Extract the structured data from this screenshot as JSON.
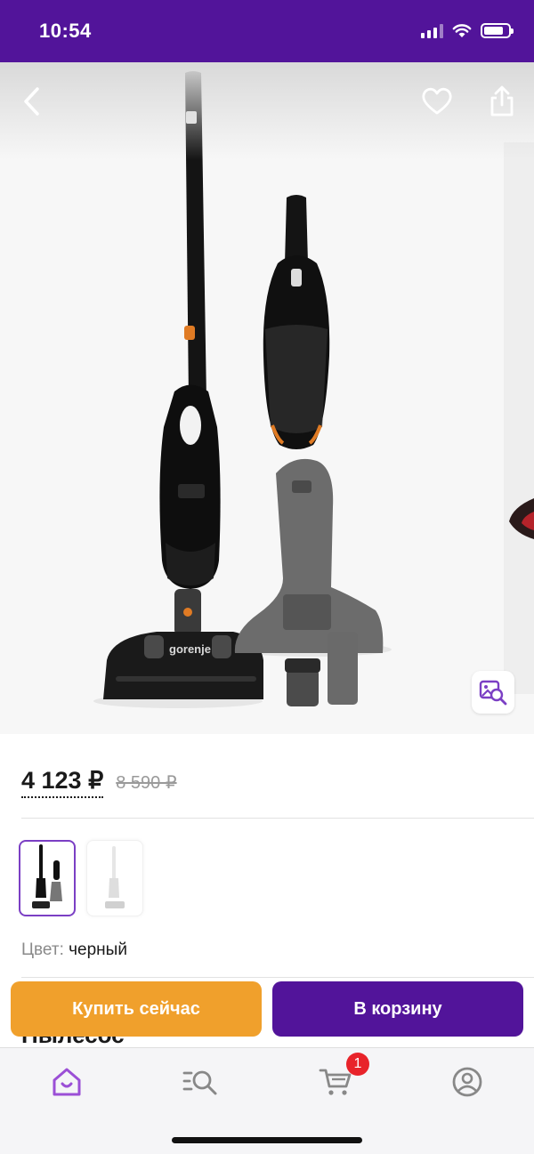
{
  "status_bar": {
    "time": "10:54",
    "background": "#52149a",
    "icons": [
      "cellular-signal-icon",
      "wifi-icon",
      "battery-icon"
    ]
  },
  "gallery": {
    "product_brand_text": "gorenje",
    "actions": [
      "back-icon",
      "heart-icon",
      "share-icon",
      "image-search-icon"
    ]
  },
  "price": {
    "current": "4 123 ₽",
    "old": "8 590 ₽"
  },
  "variants": [
    {
      "name": "черный",
      "selected": true
    },
    {
      "name": "белый",
      "selected": false
    }
  ],
  "color": {
    "label": "Цвет:",
    "value": "черный"
  },
  "title_peek": "Пылесос",
  "actions": {
    "buy_now": "Купить сейчас",
    "add_to_cart": "В корзину",
    "buy_color": "#f0a02c",
    "cart_color": "#52149a"
  },
  "tab_bar": {
    "tabs": [
      "home-icon",
      "catalog-search-icon",
      "cart-icon",
      "profile-icon"
    ],
    "cart_badge": "1",
    "active_color": "#9b4fd6"
  }
}
